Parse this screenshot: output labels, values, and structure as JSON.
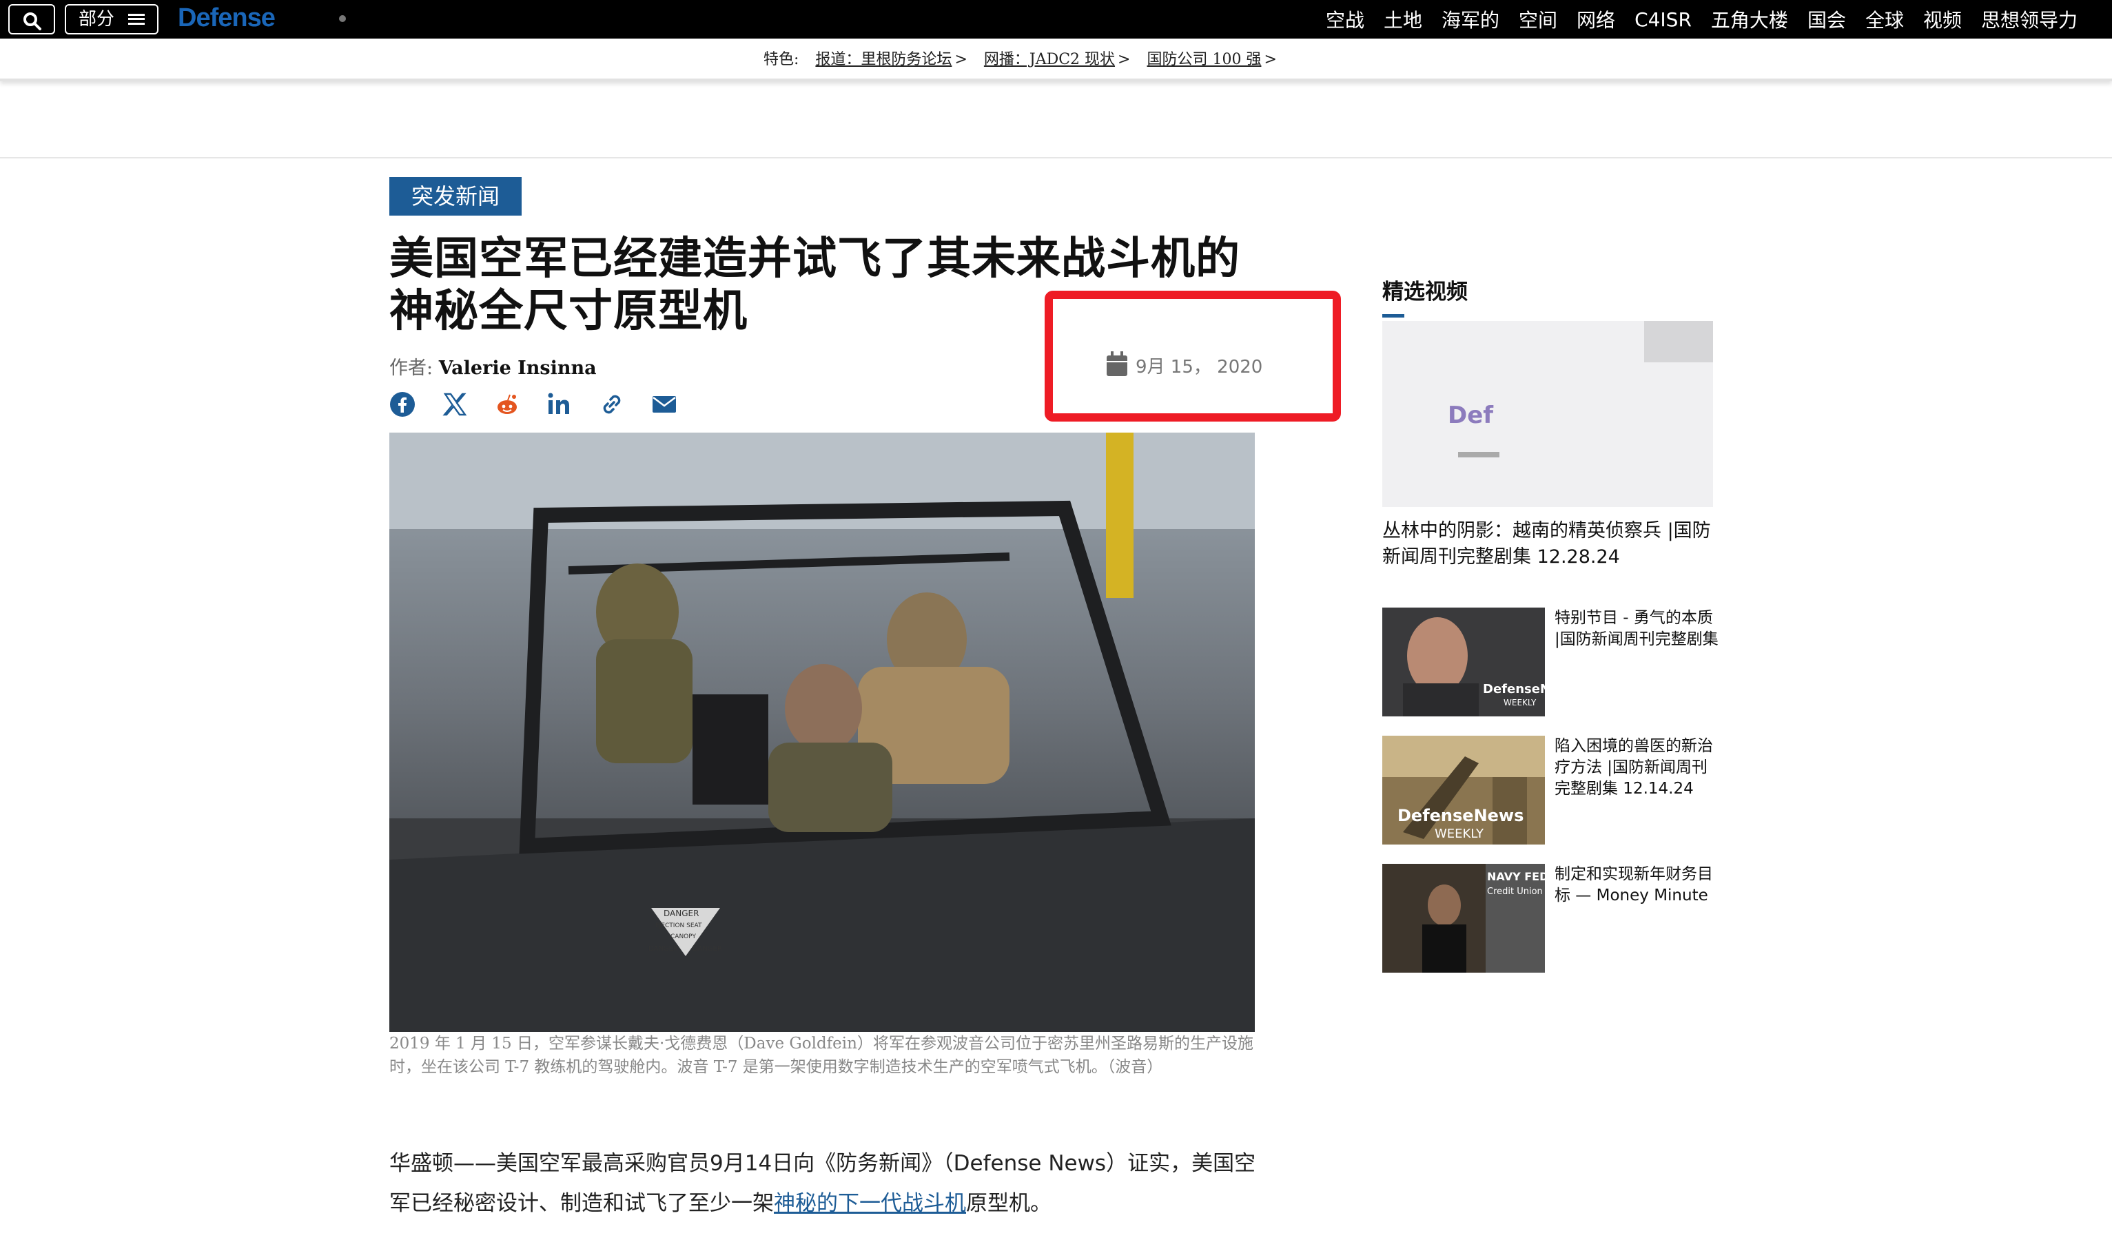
{
  "topbar": {
    "sections_label": "部分",
    "logo_text": "Defense",
    "nav": [
      "空战",
      "土地",
      "海军的",
      "空间",
      "网络",
      "C4ISR",
      "五角大楼",
      "国会",
      "全球",
      "视频",
      "思想领导力"
    ]
  },
  "featured": {
    "label": "特色:",
    "links": [
      "报道：里根防务论坛",
      "网播：JADC2 现状",
      "国防公司 100 强"
    ]
  },
  "article": {
    "tag": "突发新闻",
    "title": "美国空军已经建造并试飞了其未来战斗机的神秘全尺寸原型机",
    "byline_prefix": "作者:",
    "author": "Valerie Insinna",
    "date": "9月 15， 2020",
    "hero_text": [
      "DANGER",
      "EJECTION SEAT",
      "CANOPY",
      "DANGER",
      "DANGER"
    ],
    "caption": "2019 年 1 月 15 日，空军参谋长戴夫·戈德费恩（Dave Goldfein）将军在参观波音公司位于密苏里州圣路易斯的生产设施时，坐在该公司 T-7 教练机的驾驶舱内。波音 T-7 是第一架使用数字制造技术生产的空军喷气式飞机。（波音）",
    "body_before_link": "华盛顿——美国空军最高采购官员9月14日向《防务新闻》（Defense News）证实，美国空军已经秘密设计、制造和试飞了至少一架",
    "body_link": "神秘的下一代战斗机",
    "body_after_link": "原型机。"
  },
  "sidebar": {
    "title": "精选视频",
    "main_video_thumb_text": "Def",
    "main_video_title": "丛林中的阴影：越南的精英侦察兵 |国防新闻周刊完整剧集 12.28.24",
    "videos": [
      {
        "label": "特别节目 - 勇气的本质 |国防新闻周刊完整剧集",
        "thumb_text": "DefenseNews",
        "thumb_sub": "WEEKLY"
      },
      {
        "label": "陷入困境的兽医的新治疗方法 |国防新闻周刊完整剧集 12.14.24",
        "thumb_text": "DefenseNews",
        "thumb_sub": "WEEKLY"
      },
      {
        "label": "制定和实现新年财务目标 — Money Minute",
        "thumb_text": "NAVY FEDERAL",
        "thumb_sub": "Credit Union"
      }
    ]
  },
  "colors": {
    "accent": "#1d5c96",
    "highlight_box": "#ee1c25",
    "logo": "#1a66b8"
  }
}
